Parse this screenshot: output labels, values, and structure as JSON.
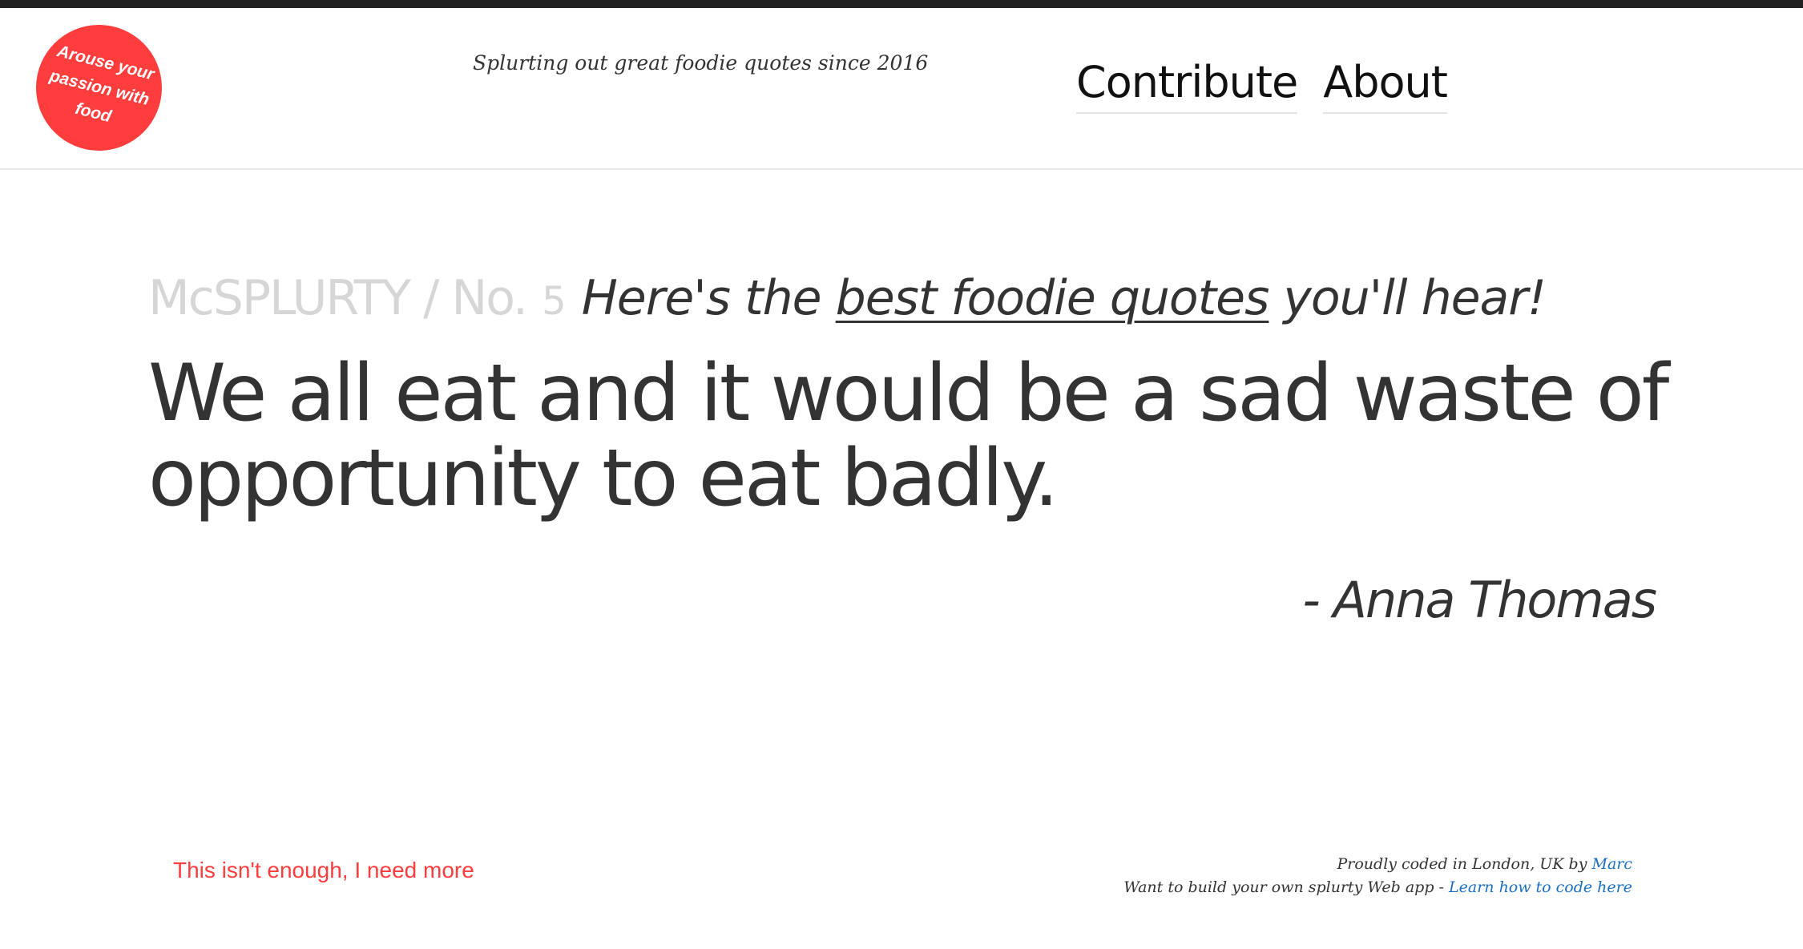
{
  "badge": {
    "text": "Arouse your passion with food",
    "color": "#ff3d3d"
  },
  "header": {
    "tagline": "Splurting out great foodie quotes since 2016",
    "nav": {
      "contribute": "Contribute",
      "about": "About"
    }
  },
  "headline": {
    "brand": "McSPLURTY",
    "separator": " / ",
    "number_prefix": "No.",
    "number": "5",
    "subtitle_before": "Here's the ",
    "subtitle_link": "best foodie quotes",
    "subtitle_after": " you'll hear!"
  },
  "quote": {
    "text": "We all eat and it would be a sad waste of opportunity to eat badly.",
    "author": "- Anna Thomas"
  },
  "more_link": "This isn't enough, I need more",
  "footer": {
    "line1_text": "Proudly coded in London, UK by ",
    "line1_link": "Marc",
    "line2_text": "Want to build your own splurty Web app - ",
    "line2_link": "Learn how to code here"
  },
  "colors": {
    "accent": "#ff3d3d",
    "link": "#1a6fc0",
    "text": "#333333",
    "muted": "#d6d6d6",
    "top_bar": "#222222"
  }
}
